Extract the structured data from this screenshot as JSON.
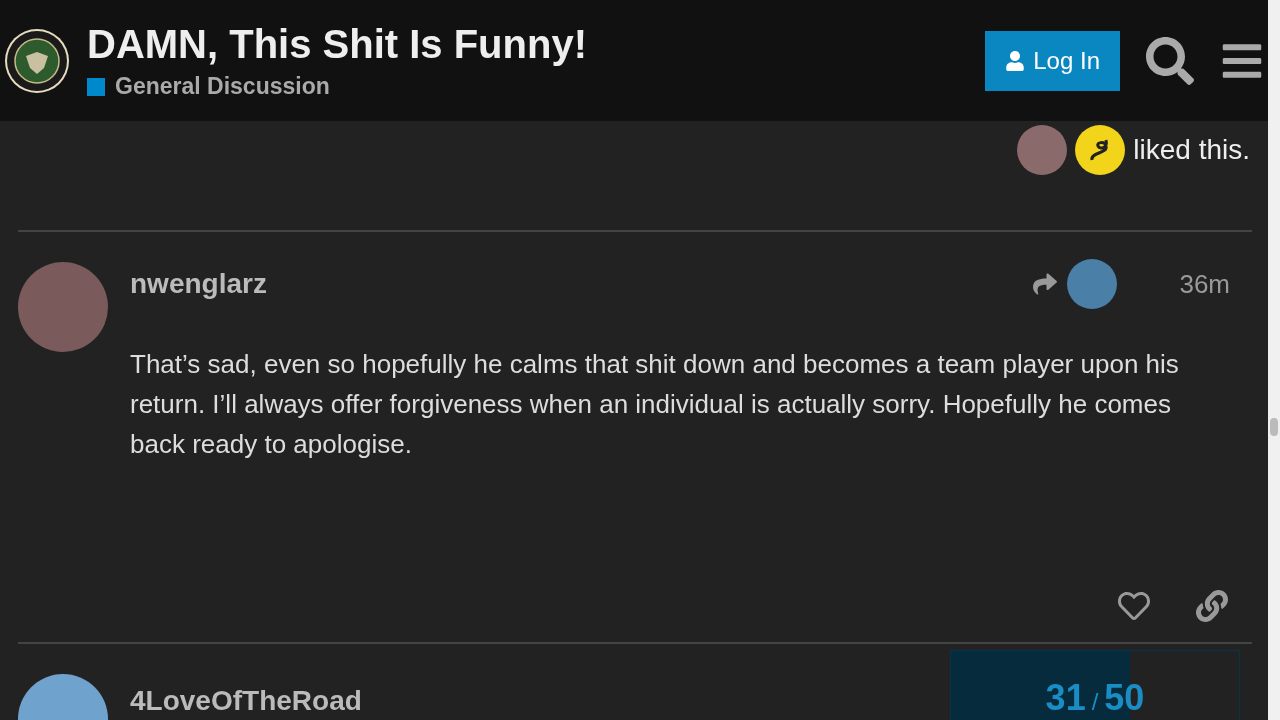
{
  "header": {
    "title": "DAMN, This Shit Is Funny!",
    "category": {
      "name": "General Discussion",
      "color": "#0088cc"
    },
    "login_button": "Log In"
  },
  "likes": {
    "text": "liked this."
  },
  "posts": [
    {
      "username": "nwenglarz",
      "time": "36m",
      "body": "That’s sad, even so hopefully he calms that shit down and becomes a team player upon his return. I’ll always offer forgiveness when an individual is actually sorry. Hopefully he comes back ready to apologise."
    },
    {
      "username": "4LoveOfTheRoad"
    }
  ],
  "progress": {
    "current": "31",
    "separator": "/",
    "total": "50",
    "level": 0.62
  }
}
